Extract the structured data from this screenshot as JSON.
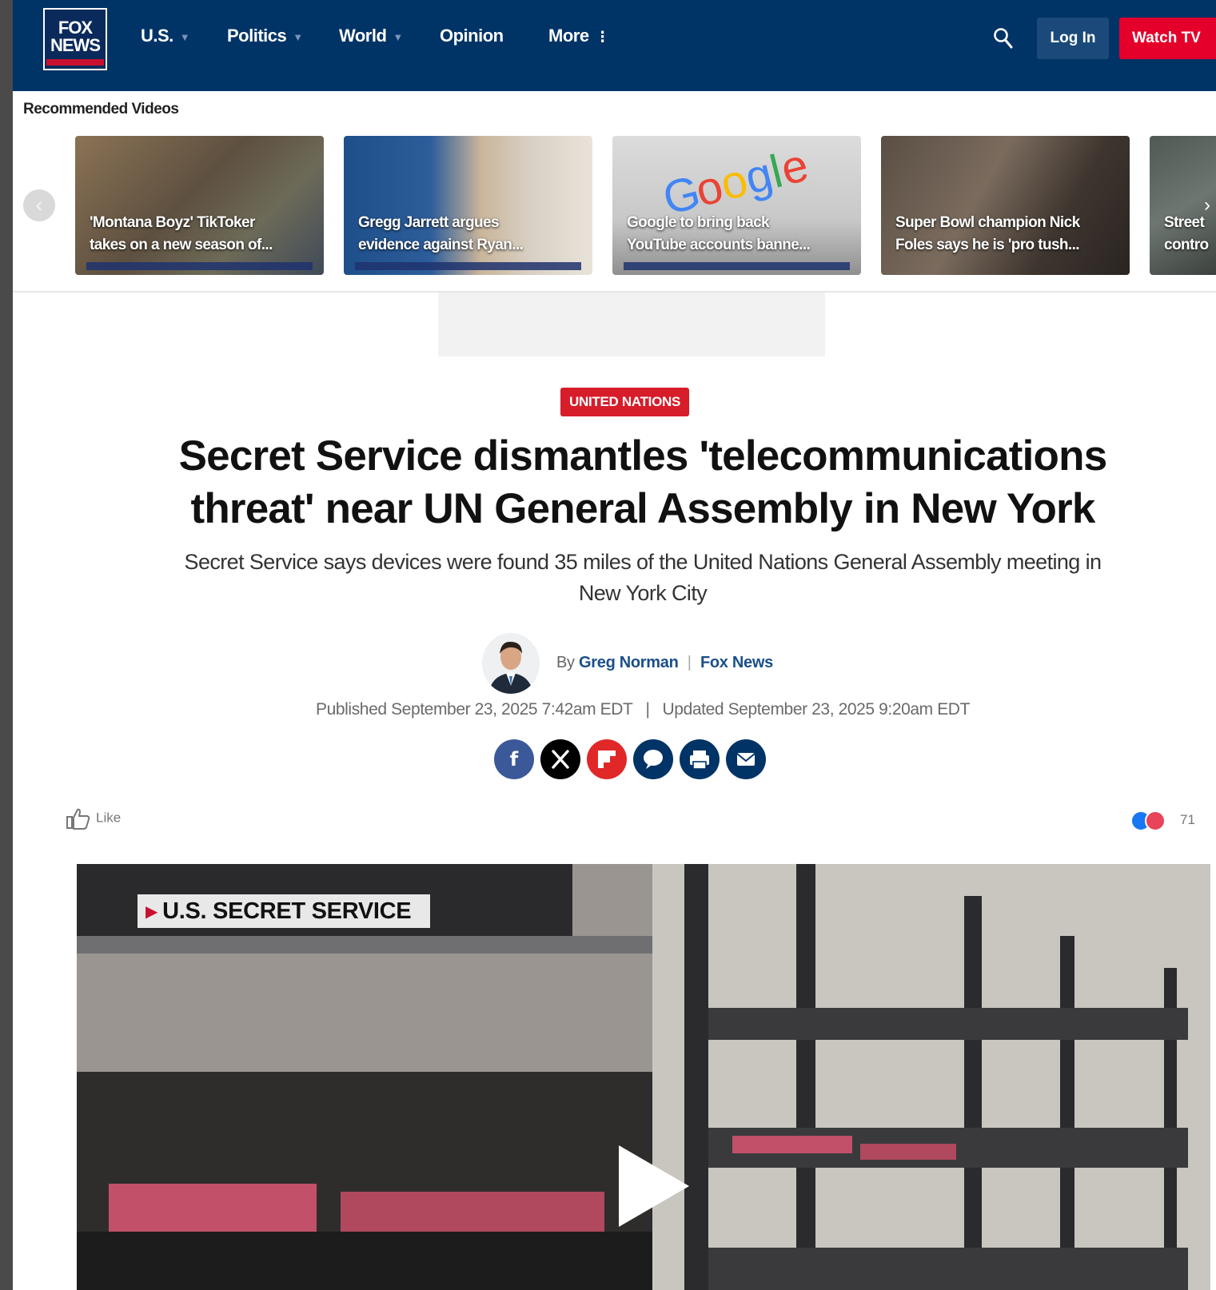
{
  "header": {
    "logo_line1": "FOX",
    "logo_line2": "NEWS",
    "nav": [
      {
        "label": "U.S.",
        "has_caret": true
      },
      {
        "label": "Politics",
        "has_caret": true
      },
      {
        "label": "World",
        "has_caret": true
      },
      {
        "label": "Opinion",
        "has_caret": false
      },
      {
        "label": "More",
        "has_caret": false
      }
    ],
    "more_icon": "⋮",
    "caret": "▼",
    "login_label": "Log In",
    "watch_label": "Watch TV"
  },
  "recommended": {
    "title": "Recommended Videos",
    "prev_glyph": "‹",
    "next_glyph": "›",
    "cards": [
      {
        "caption_line1": "'Montana Boyz' TikToker",
        "caption_line2": "takes on a new season of..."
      },
      {
        "caption_line1": "Gregg Jarrett argues",
        "caption_line2": "evidence against Ryan..."
      },
      {
        "caption_line1": "Google to bring back",
        "caption_line2": "YouTube accounts banne...",
        "logo_text": "Google"
      },
      {
        "caption_line1": "Super Bowl champion Nick",
        "caption_line2": "Foles says he is 'pro tush..."
      },
      {
        "caption_line1": "Street",
        "caption_line2": "contro"
      }
    ]
  },
  "article": {
    "eyebrow": "UNITED NATIONS",
    "headline_line1": "Secret Service dismantles 'telecommunications",
    "headline_line2": "threat' near UN General Assembly in New York",
    "subhead_line1": "Secret Service says devices were found 35 miles of the United Nations General Assembly meeting in",
    "subhead_line2": "New York City",
    "by_prefix": "By",
    "author": "Greg Norman",
    "separator": "|",
    "source": "Fox News",
    "published": "Published September 23, 2025 7:42am EDT",
    "updated": "Updated September 23, 2025 9:20am EDT",
    "date_pipe": "|"
  },
  "share": [
    {
      "icon": "facebook-icon",
      "glyph": "f",
      "color": "#3b5998"
    },
    {
      "icon": "x-icon",
      "glyph": "𝕏",
      "color": "#000000"
    },
    {
      "icon": "flipboard-icon",
      "glyph": "",
      "color": "#e12828"
    },
    {
      "icon": "comment-icon",
      "glyph": "",
      "color": "#003366"
    },
    {
      "icon": "print-icon",
      "glyph": "",
      "color": "#003366"
    },
    {
      "icon": "email-icon",
      "glyph": "",
      "color": "#003366"
    }
  ],
  "engagement": {
    "like_label": "Like",
    "reaction_count": "71"
  },
  "video": {
    "label": "U.S. SECRET SERVICE"
  },
  "colors": {
    "nav_bg": "#003366",
    "accent_red": "#e4002b",
    "link_blue": "#1a4f8a"
  }
}
